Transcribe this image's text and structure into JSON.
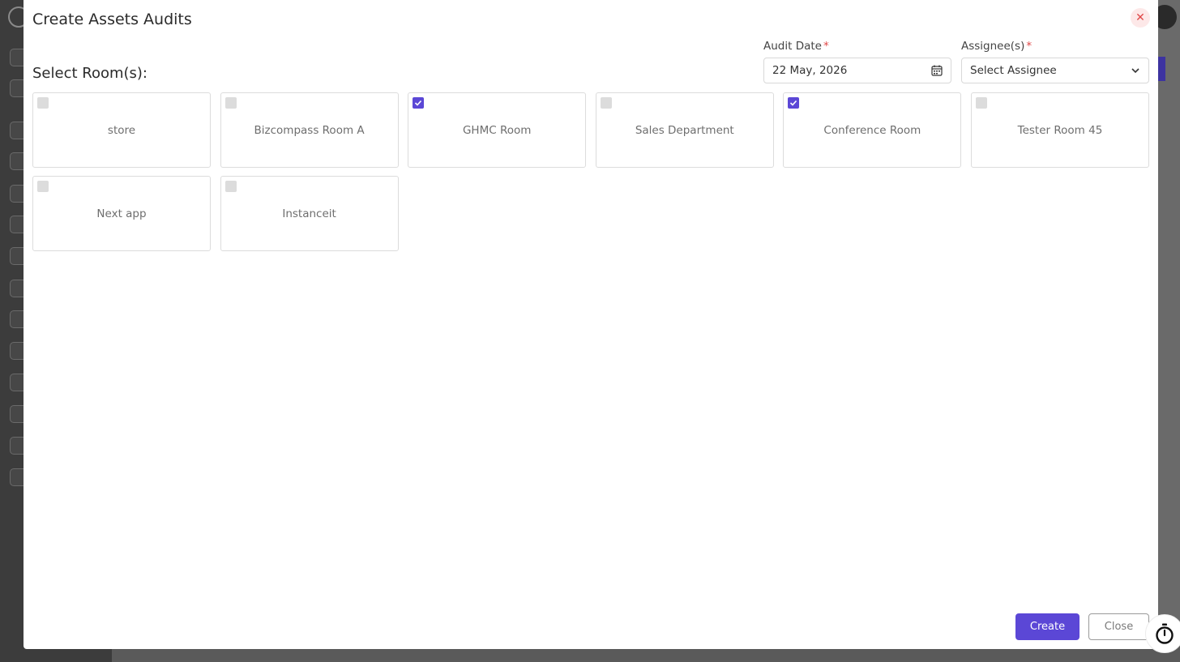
{
  "modal": {
    "title": "Create Assets Audits",
    "close_icon": "close-icon",
    "select_rooms_label": "Select Room(s):"
  },
  "audit_date": {
    "label": "Audit Date",
    "required_mark": "*",
    "value": "22 May, 2026",
    "icon": "calendar-icon"
  },
  "assignee": {
    "label": "Assignee(s)",
    "required_mark": "*",
    "value": "Select Assignee",
    "icon": "chevron-down-icon"
  },
  "rooms": [
    {
      "name": "store",
      "checked": false
    },
    {
      "name": "Bizcompass Room A",
      "checked": false
    },
    {
      "name": "GHMC Room",
      "checked": true
    },
    {
      "name": "Sales Department",
      "checked": false
    },
    {
      "name": "Conference Room",
      "checked": true
    },
    {
      "name": "Tester Room 45",
      "checked": false
    },
    {
      "name": "Next app",
      "checked": false
    },
    {
      "name": "Instanceit",
      "checked": false
    }
  ],
  "buttons": {
    "create": "Create",
    "close": "Close"
  },
  "colors": {
    "accent": "#5b47d6",
    "danger": "#e04848"
  }
}
